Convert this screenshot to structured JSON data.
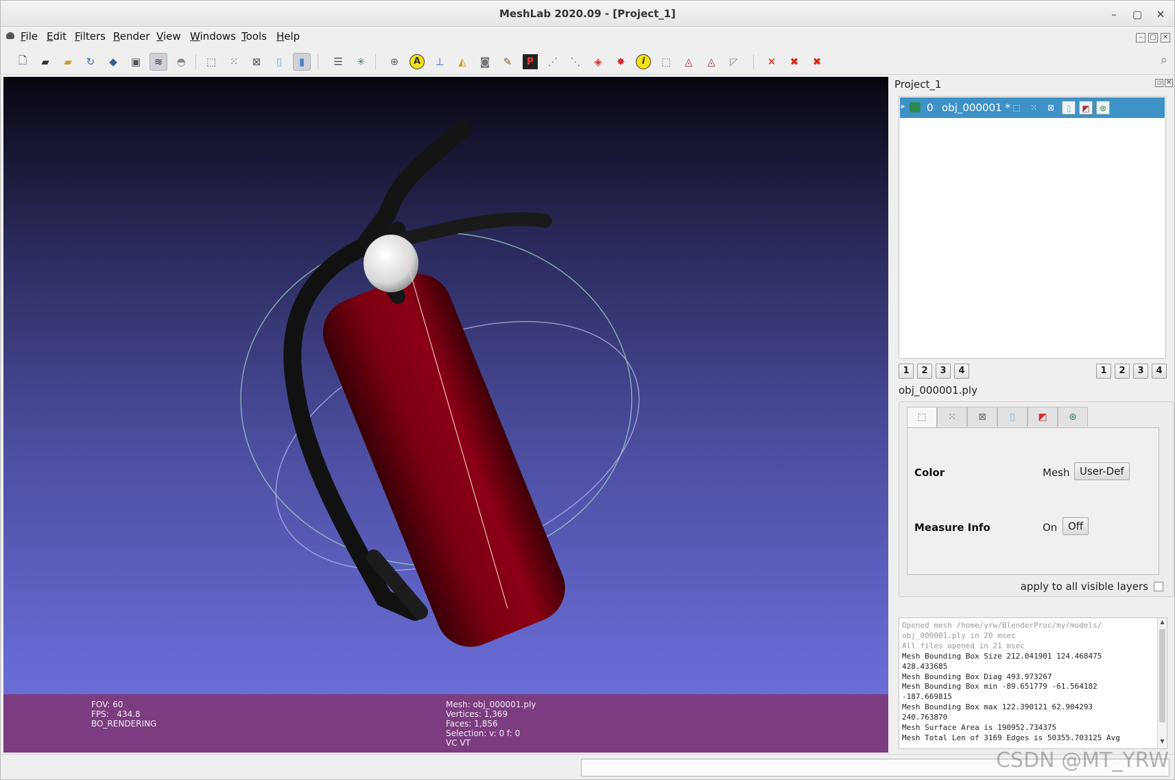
{
  "window": {
    "title": "MeshLab 2020.09 - [Project_1]",
    "controls": [
      "–",
      "▢",
      "✕"
    ]
  },
  "menu": [
    "File",
    "Edit",
    "Filters",
    "Render",
    "View",
    "Windows",
    "Tools",
    "Help"
  ],
  "toolbar": {
    "icons": [
      "new-project-icon",
      "open-project-icon",
      "import-mesh-icon",
      "reload-icon",
      "export-mesh-icon",
      "snapshot-icon",
      "layers-icon",
      "full-screen-icon",
      "bounding-box-icon",
      "points-icon",
      "wireframe-icon",
      "flat-icon",
      "smooth-icon",
      "layer-stack-icon",
      "trackball-icon",
      "sphere-icon",
      "annotation-icon",
      "axes-icon",
      "paint-bucket-icon",
      "camera-icon",
      "brush-icon",
      "pickpoint-icon",
      "align-icon",
      "measure-icon",
      "georef-icon",
      "geo-red-icon",
      "info-icon",
      "select-vertices-icon",
      "select-faces-icon",
      "select-connected-icon",
      "select-area-icon",
      "delete-vertices-icon",
      "delete-faces-icon",
      "delete-selection-icon"
    ]
  },
  "viewport": {
    "info_left": [
      "FOV: 60",
      "FPS:   434.8",
      "BO_RENDERING"
    ],
    "info_mid": [
      "Mesh: obj_000001.ply",
      "Vertices: 1,369",
      "Faces: 1,856",
      "Selection: v: 0 f: 0",
      "VC VT"
    ]
  },
  "layers_panel": {
    "title": "Project_1",
    "layers": [
      {
        "index": "0",
        "name": "obj_000001 *"
      }
    ],
    "left_buttons": [
      "1",
      "2",
      "3",
      "4"
    ],
    "right_buttons": [
      "1",
      "2",
      "3",
      "4"
    ]
  },
  "decoration": {
    "mesh_file": "obj_000001.ply",
    "color": {
      "label": "Color",
      "text": "Mesh",
      "button": "User-Def"
    },
    "measure": {
      "label": "Measure Info",
      "on": "On",
      "off": "Off"
    },
    "apply_all": "apply to all visible layers"
  },
  "log": {
    "lines": [
      {
        "text": "Opened mesh /home/yrw/BlenderProc/my/models/",
        "muted": true
      },
      {
        "text": "obj_000001.ply in 20 msec",
        "muted": true
      },
      {
        "text": "All files opened in 21 msec",
        "muted": true
      },
      {
        "text": "Mesh Bounding Box Size 212.041901 124.468475",
        "muted": false
      },
      {
        "text": "428.433685",
        "muted": false
      },
      {
        "text": "Mesh Bounding Box Diag 493.973267",
        "muted": false
      },
      {
        "text": "Mesh Bounding Box min -89.651779 -61.564182",
        "muted": false
      },
      {
        "text": "-187.669815",
        "muted": false
      },
      {
        "text": "Mesh Bounding Box max 122.390121 62.904293",
        "muted": false
      },
      {
        "text": "240.763870",
        "muted": false
      },
      {
        "text": "Mesh Surface Area is 190952.734375",
        "muted": false
      },
      {
        "text": "Mesh Total Len of 3169 Edges is 50355.703125 Avg",
        "muted": false
      }
    ]
  },
  "watermark": "CSDN @MT_YRW"
}
